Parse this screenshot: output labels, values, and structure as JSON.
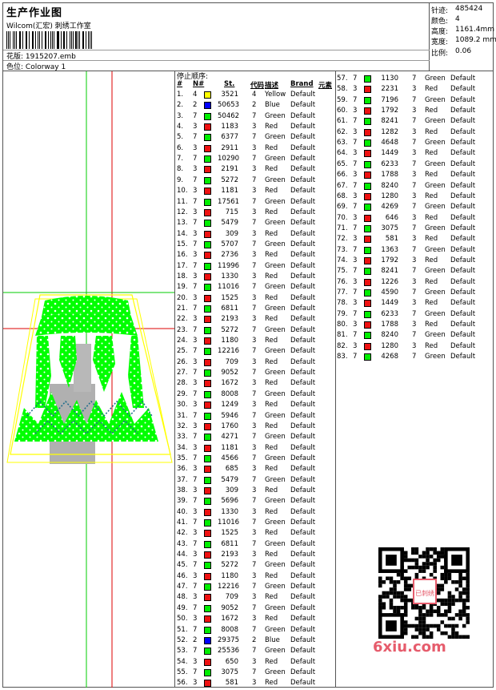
{
  "header": {
    "title": "生产作业图",
    "company": "Wilcom(汇宏) 刺绣工作室",
    "design_label": "花版:",
    "design_value": "1915207.emb",
    "colorway_label": "色位:",
    "colorway_value": "Colorway 1"
  },
  "stats": [
    {
      "label": "针迹:",
      "value": "485424"
    },
    {
      "label": "颜色:",
      "value": "4"
    },
    {
      "label": "高度:",
      "value": "1161.4mm"
    },
    {
      "label": "宽度:",
      "value": "1089.2 mm"
    },
    {
      "label": "比例:",
      "value": "0.06"
    }
  ],
  "stop_sequence_title": "停止顺序:",
  "table_headers": {
    "num": "#",
    "n": "N#",
    "st": "St.",
    "code": "代码",
    "desc": "描述",
    "brand": "Brand",
    "element": "元素"
  },
  "colors": {
    "Yellow": "#ffff00",
    "Blue": "#0000ff",
    "Green": "#00ee00",
    "Red": "#ee1111"
  },
  "rows": [
    [
      "1.",
      "4",
      "3521",
      "4",
      "Yellow",
      "Default"
    ],
    [
      "2.",
      "2",
      "50653",
      "2",
      "Blue",
      "Default"
    ],
    [
      "3.",
      "7",
      "50462",
      "7",
      "Green",
      "Default"
    ],
    [
      "4.",
      "3",
      "1183",
      "3",
      "Red",
      "Default"
    ],
    [
      "5.",
      "7",
      "6377",
      "7",
      "Green",
      "Default"
    ],
    [
      "6.",
      "3",
      "2911",
      "3",
      "Red",
      "Default"
    ],
    [
      "7.",
      "7",
      "10290",
      "7",
      "Green",
      "Default"
    ],
    [
      "8.",
      "3",
      "2191",
      "3",
      "Red",
      "Default"
    ],
    [
      "9.",
      "7",
      "5272",
      "7",
      "Green",
      "Default"
    ],
    [
      "10.",
      "3",
      "1181",
      "3",
      "Red",
      "Default"
    ],
    [
      "11.",
      "7",
      "17561",
      "7",
      "Green",
      "Default"
    ],
    [
      "12.",
      "3",
      "715",
      "3",
      "Red",
      "Default"
    ],
    [
      "13.",
      "7",
      "5479",
      "7",
      "Green",
      "Default"
    ],
    [
      "14.",
      "3",
      "309",
      "3",
      "Red",
      "Default"
    ],
    [
      "15.",
      "7",
      "5707",
      "7",
      "Green",
      "Default"
    ],
    [
      "16.",
      "3",
      "2736",
      "3",
      "Red",
      "Default"
    ],
    [
      "17.",
      "7",
      "11996",
      "7",
      "Green",
      "Default"
    ],
    [
      "18.",
      "3",
      "1330",
      "3",
      "Red",
      "Default"
    ],
    [
      "19.",
      "7",
      "11016",
      "7",
      "Green",
      "Default"
    ],
    [
      "20.",
      "3",
      "1525",
      "3",
      "Red",
      "Default"
    ],
    [
      "21.",
      "7",
      "6811",
      "7",
      "Green",
      "Default"
    ],
    [
      "22.",
      "3",
      "2193",
      "3",
      "Red",
      "Default"
    ],
    [
      "23.",
      "7",
      "5272",
      "7",
      "Green",
      "Default"
    ],
    [
      "24.",
      "3",
      "1180",
      "3",
      "Red",
      "Default"
    ],
    [
      "25.",
      "7",
      "12216",
      "7",
      "Green",
      "Default"
    ],
    [
      "26.",
      "3",
      "709",
      "3",
      "Red",
      "Default"
    ],
    [
      "27.",
      "7",
      "9052",
      "7",
      "Green",
      "Default"
    ],
    [
      "28.",
      "3",
      "1672",
      "3",
      "Red",
      "Default"
    ],
    [
      "29.",
      "7",
      "8008",
      "7",
      "Green",
      "Default"
    ],
    [
      "30.",
      "3",
      "1249",
      "3",
      "Red",
      "Default"
    ],
    [
      "31.",
      "7",
      "5946",
      "7",
      "Green",
      "Default"
    ],
    [
      "32.",
      "3",
      "1760",
      "3",
      "Red",
      "Default"
    ],
    [
      "33.",
      "7",
      "4271",
      "7",
      "Green",
      "Default"
    ],
    [
      "34.",
      "3",
      "1181",
      "3",
      "Red",
      "Default"
    ],
    [
      "35.",
      "7",
      "4566",
      "7",
      "Green",
      "Default"
    ],
    [
      "36.",
      "3",
      "685",
      "3",
      "Red",
      "Default"
    ],
    [
      "37.",
      "7",
      "5479",
      "7",
      "Green",
      "Default"
    ],
    [
      "38.",
      "3",
      "309",
      "3",
      "Red",
      "Default"
    ],
    [
      "39.",
      "7",
      "5696",
      "7",
      "Green",
      "Default"
    ],
    [
      "40.",
      "3",
      "1330",
      "3",
      "Red",
      "Default"
    ],
    [
      "41.",
      "7",
      "11016",
      "7",
      "Green",
      "Default"
    ],
    [
      "42.",
      "3",
      "1525",
      "3",
      "Red",
      "Default"
    ],
    [
      "43.",
      "7",
      "6811",
      "7",
      "Green",
      "Default"
    ],
    [
      "44.",
      "3",
      "2193",
      "3",
      "Red",
      "Default"
    ],
    [
      "45.",
      "7",
      "5272",
      "7",
      "Green",
      "Default"
    ],
    [
      "46.",
      "3",
      "1180",
      "3",
      "Red",
      "Default"
    ],
    [
      "47.",
      "7",
      "12216",
      "7",
      "Green",
      "Default"
    ],
    [
      "48.",
      "3",
      "709",
      "3",
      "Red",
      "Default"
    ],
    [
      "49.",
      "7",
      "9052",
      "7",
      "Green",
      "Default"
    ],
    [
      "50.",
      "3",
      "1672",
      "3",
      "Red",
      "Default"
    ],
    [
      "51.",
      "7",
      "8008",
      "7",
      "Green",
      "Default"
    ],
    [
      "52.",
      "2",
      "29375",
      "2",
      "Blue",
      "Default"
    ],
    [
      "53.",
      "7",
      "25536",
      "7",
      "Green",
      "Default"
    ],
    [
      "54.",
      "3",
      "650",
      "3",
      "Red",
      "Default"
    ],
    [
      "55.",
      "7",
      "3075",
      "7",
      "Green",
      "Default"
    ],
    [
      "56.",
      "3",
      "581",
      "3",
      "Red",
      "Default"
    ],
    [
      "57.",
      "7",
      "1130",
      "7",
      "Green",
      "Default"
    ],
    [
      "58.",
      "3",
      "2231",
      "3",
      "Red",
      "Default"
    ],
    [
      "59.",
      "7",
      "7196",
      "7",
      "Green",
      "Default"
    ],
    [
      "60.",
      "3",
      "1792",
      "3",
      "Red",
      "Default"
    ],
    [
      "61.",
      "7",
      "8241",
      "7",
      "Green",
      "Default"
    ],
    [
      "62.",
      "3",
      "1282",
      "3",
      "Red",
      "Default"
    ],
    [
      "63.",
      "7",
      "4648",
      "7",
      "Green",
      "Default"
    ],
    [
      "64.",
      "3",
      "1449",
      "3",
      "Red",
      "Default"
    ],
    [
      "65.",
      "7",
      "6233",
      "7",
      "Green",
      "Default"
    ],
    [
      "66.",
      "3",
      "1788",
      "3",
      "Red",
      "Default"
    ],
    [
      "67.",
      "7",
      "8240",
      "7",
      "Green",
      "Default"
    ],
    [
      "68.",
      "3",
      "1280",
      "3",
      "Red",
      "Default"
    ],
    [
      "69.",
      "7",
      "4269",
      "7",
      "Green",
      "Default"
    ],
    [
      "70.",
      "3",
      "646",
      "3",
      "Red",
      "Default"
    ],
    [
      "71.",
      "7",
      "3075",
      "7",
      "Green",
      "Default"
    ],
    [
      "72.",
      "3",
      "581",
      "3",
      "Red",
      "Default"
    ],
    [
      "73.",
      "7",
      "1363",
      "7",
      "Green",
      "Default"
    ],
    [
      "74.",
      "3",
      "1792",
      "3",
      "Red",
      "Default"
    ],
    [
      "75.",
      "7",
      "8241",
      "7",
      "Green",
      "Default"
    ],
    [
      "76.",
      "3",
      "1226",
      "3",
      "Red",
      "Default"
    ],
    [
      "77.",
      "7",
      "4590",
      "7",
      "Green",
      "Default"
    ],
    [
      "78.",
      "3",
      "1449",
      "3",
      "Red",
      "Default"
    ],
    [
      "79.",
      "7",
      "6233",
      "7",
      "Green",
      "Default"
    ],
    [
      "80.",
      "3",
      "1788",
      "3",
      "Red",
      "Default"
    ],
    [
      "81.",
      "7",
      "8240",
      "7",
      "Green",
      "Default"
    ],
    [
      "82.",
      "3",
      "1280",
      "3",
      "Red",
      "Default"
    ],
    [
      "83.",
      "7",
      "4268",
      "7",
      "Green",
      "Default"
    ]
  ],
  "watermark": {
    "site": "6xiu.com",
    "seal": "已刺绣"
  }
}
